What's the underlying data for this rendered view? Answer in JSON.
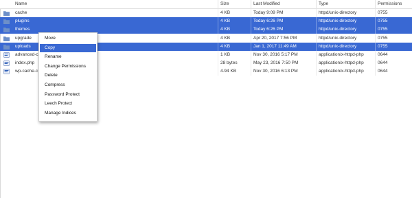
{
  "columns": {
    "name": "Name",
    "size": "Size",
    "modified": "Last Modified",
    "type": "Type",
    "permissions": "Permissions"
  },
  "rows": [
    {
      "name": "cache",
      "size": "4 KB",
      "modified": "Today 9:09 PM",
      "type": "httpd/unix-directory",
      "perm": "0755",
      "icon": "folder-icon",
      "selected": false
    },
    {
      "name": "plugins",
      "size": "4 KB",
      "modified": "Today 6:26 PM",
      "type": "httpd/unix-directory",
      "perm": "0755",
      "icon": "folder-icon",
      "selected": true
    },
    {
      "name": "themes",
      "size": "4 KB",
      "modified": "Today 6:26 PM",
      "type": "httpd/unix-directory",
      "perm": "0755",
      "icon": "folder-icon",
      "selected": true
    },
    {
      "name": "upgrade",
      "size": "4 KB",
      "modified": "Apr 20, 2017 7:56 PM",
      "type": "httpd/unix-directory",
      "perm": "0755",
      "icon": "folder-icon",
      "selected": false
    },
    {
      "name": "uploads",
      "size": "4 KB",
      "modified": "Jan 1, 2017 11:49 AM",
      "type": "httpd/unix-directory",
      "perm": "0755",
      "icon": "folder-icon",
      "selected": true
    },
    {
      "name": "advanced-c",
      "size": "1 KB",
      "modified": "Nov 30, 2016 5:17 PM",
      "type": "application/x-httpd-php",
      "perm": "0644",
      "icon": "php-file-icon",
      "selected": false
    },
    {
      "name": "index.php",
      "size": "28 bytes",
      "modified": "May 23, 2016 7:50 PM",
      "type": "application/x-httpd-php",
      "perm": "0644",
      "icon": "php-file-icon",
      "selected": false
    },
    {
      "name": "wp-cache-c",
      "size": "4.94 KB",
      "modified": "Nov 30, 2016 6:13 PM",
      "type": "application/x-httpd-php",
      "perm": "0644",
      "icon": "php-file-icon",
      "selected": false
    }
  ],
  "context_menu": {
    "items": [
      "Move",
      "Copy",
      "Rename",
      "Change Permissions",
      "Delete",
      "Compress",
      "Password Protect",
      "Leech Protect",
      "Manage Indices"
    ],
    "active_index": 1
  },
  "colors": {
    "selection": "#3968d3",
    "folder": "#6d8fc9"
  }
}
